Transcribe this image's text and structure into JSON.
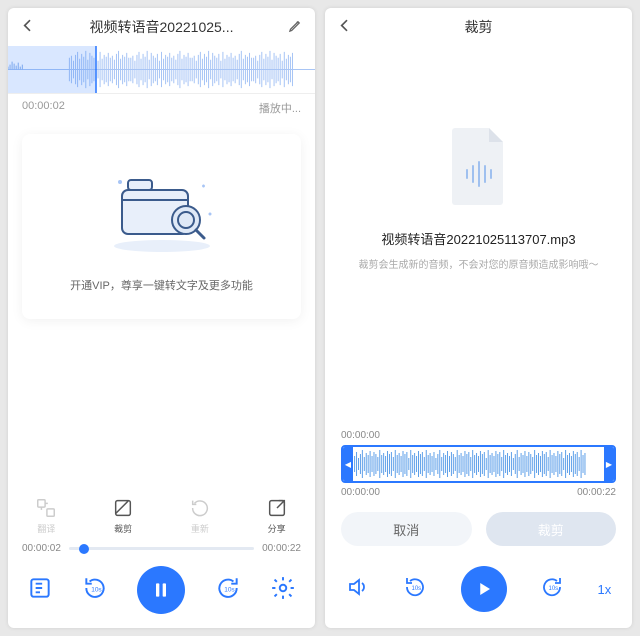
{
  "colors": {
    "accent": "#2b78ff"
  },
  "left": {
    "title": "视频转语音20221025...",
    "current_time": "00:00:02",
    "status": "播放中...",
    "vip_text": "开通VIP，尊享一键转文字及更多功能",
    "actions": {
      "translate": "翻译",
      "trim": "裁剪",
      "rerecord": "重新",
      "share": "分享"
    },
    "progress": {
      "pos": "00:00:02",
      "dur": "00:00:22"
    },
    "skip_label": "10s"
  },
  "right": {
    "title": "裁剪",
    "filename": "视频转语音20221025113707.mp3",
    "subtext": "裁剪会生成新的音频，不会对您的原音频造成影响哦～",
    "trim_start": "00:00:00",
    "trim_range_start": "00:00:00",
    "trim_range_end": "00:00:22",
    "cancel": "取消",
    "confirm": "裁剪",
    "skip_label": "10s",
    "speed": "1x"
  }
}
